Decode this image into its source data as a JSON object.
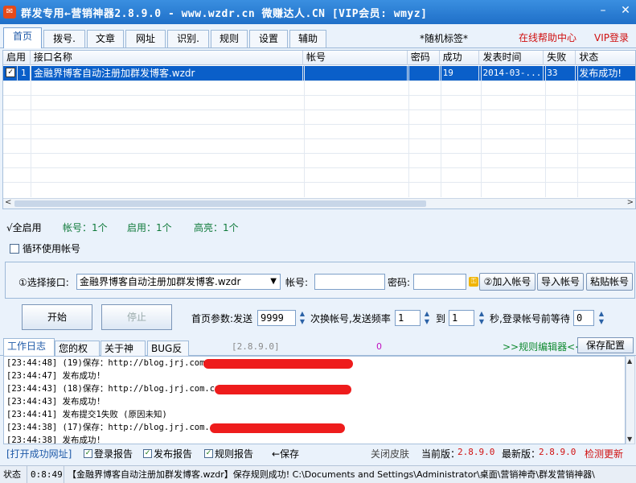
{
  "window": {
    "title": "群发专用←营销神器2.8.9.0 - www.wzdr.cn 微赚达人.CN [VIP会员: wmyz]"
  },
  "tabs": [
    "首页",
    "拨号.关",
    "文章",
    "网址库",
    "识别.关",
    "规则",
    "设置",
    "辅助"
  ],
  "header": {
    "random_tag": "*随机标签*",
    "help_center": "在线帮助中心",
    "vip_login": "VIP登录"
  },
  "grid": {
    "columns": [
      "启用",
      "接口名称",
      "帐号",
      "密码",
      "成功",
      "发表时间",
      "失败",
      "状态"
    ],
    "rows": [
      {
        "enabled": "✓",
        "index": "1",
        "name": "金融界博客自动注册加群发博客.wzdr",
        "account": "",
        "password": "",
        "success": "19",
        "time": "2014-03-...",
        "fail": "33",
        "status": "发布成功!"
      }
    ]
  },
  "stats": {
    "enable_all": "√全启用",
    "accounts": "帐号：1个",
    "enabled": "启用：1个",
    "highlighted": "高亮：1个",
    "loop_label": "循环使用帐号"
  },
  "interface": {
    "select_label": "①选择接口:",
    "selected": "金融界博客自动注册加群发博客.wzdr",
    "account_label": "帐号:",
    "password_label": "密码:",
    "add_account": "②加入帐号",
    "import_account": "导入帐号",
    "paste_account": "粘贴帐号"
  },
  "controls": {
    "start": "开始",
    "stop": "停止",
    "params_label": "首页参数:发送",
    "send_count": "9999",
    "switch_label": "次换帐号,发送频率",
    "freq_from": "1",
    "to_label": "到",
    "freq_to": "1",
    "wait_label": "秒,登录帐号前等待",
    "wait_value": "0"
  },
  "log_tabs": [
    "工作日志",
    "您的权限",
    "关于神器",
    "BUG反馈"
  ],
  "log_header": {
    "version": "[2.8.9.0]",
    "count": "0",
    "rule_editor": ">>规则编辑器<<",
    "save_config": "保存配置"
  },
  "log_lines": [
    "[23:44:48] (19)保存：http://blog.jrj.com",
    "[23:44:47] 发布成功!",
    "[23:44:43] (18)保存：http://blog.jrj.com.cn",
    "[23:44:43] 发布成功!",
    "[23:44:41] 发布提交1失败 (原因未知)",
    "[23:44:38] (17)保存：http://blog.jrj.com.c",
    "[23:44:38] 发布成功!"
  ],
  "bottom_bar": {
    "open_success": "[打开成功网址]",
    "login_report": "登录报告",
    "publish_report": "发布报告",
    "rule_report": "规则报告",
    "save": "←保存",
    "close_skin": "关闭皮肤",
    "current_label": "当前版：",
    "current_version": "2.8.9.0",
    "latest_label": "最新版：",
    "latest_version": "2.8.9.0",
    "check_update": "检测更新"
  },
  "status_bar": {
    "label": "状态",
    "time": "0:8:49",
    "message": "【金融界博客自动注册加群发博客.wzdr】保存规则成功! C:\\Documents and Settings\\Administrator\\桌面\\营销神奇\\群发营销神器\\"
  },
  "colors": {
    "title_blue": "#1f6fc8",
    "selection_blue": "#0a5fc9",
    "link_red": "#d01010",
    "stat_green": "#0f7a3a",
    "redaction_red": "#ee1c1c"
  }
}
